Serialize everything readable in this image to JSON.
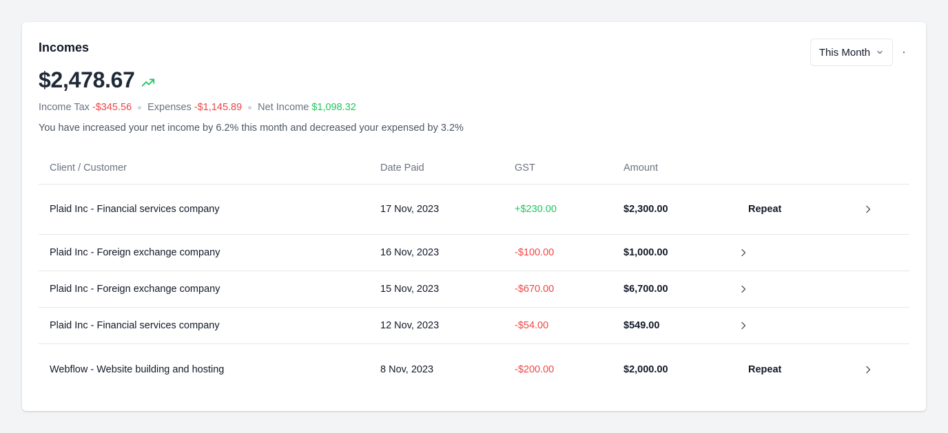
{
  "card": {
    "title": "Incomes",
    "period_label": "This Month",
    "total": "$2,478.67",
    "summary": {
      "tax_label": "Income Tax",
      "tax_value": "-$345.56",
      "expenses_label": "Expenses",
      "expenses_value": "-$1,145.89",
      "net_label": "Net Income",
      "net_value": "$1,098.32"
    },
    "note": "You have increased your net income by 6.2% this month and decreased your expensed by 3.2%"
  },
  "table": {
    "headers": [
      "Client / Customer",
      "Date Paid",
      "GST",
      "Amount"
    ],
    "rows": [
      {
        "client": "Plaid Inc - Financial services company",
        "date": "17 Nov, 2023",
        "gst": "+$230.00",
        "amount": "$2,300.00",
        "action": "Repeat"
      },
      {
        "client": "Plaid Inc - Foreign exchange company",
        "date": "16 Nov, 2023",
        "gst": "-$100.00",
        "amount": "$1,000.00",
        "action": ""
      },
      {
        "client": "Plaid Inc - Foreign exchange company",
        "date": "15 Nov, 2023",
        "gst": "-$670.00",
        "amount": "$6,700.00",
        "action": ""
      },
      {
        "client": "Plaid Inc - Financial services company",
        "date": "12 Nov, 2023",
        "gst": "-$54.00",
        "amount": "$549.00",
        "action": ""
      },
      {
        "client": "Webflow - Website building and hosting",
        "date": "8 Nov, 2023",
        "gst": "-$200.00",
        "amount": "$2,000.00",
        "action": "Repeat"
      }
    ]
  },
  "colors": {
    "positive": "#22c55e",
    "negative": "#ef4444",
    "muted": "#6b7280"
  },
  "icons": {
    "trend": "trending-up-icon",
    "dropdown": "chevron-down-icon",
    "row_action": "chevron-right-icon",
    "menu": "more-dot-icon"
  }
}
